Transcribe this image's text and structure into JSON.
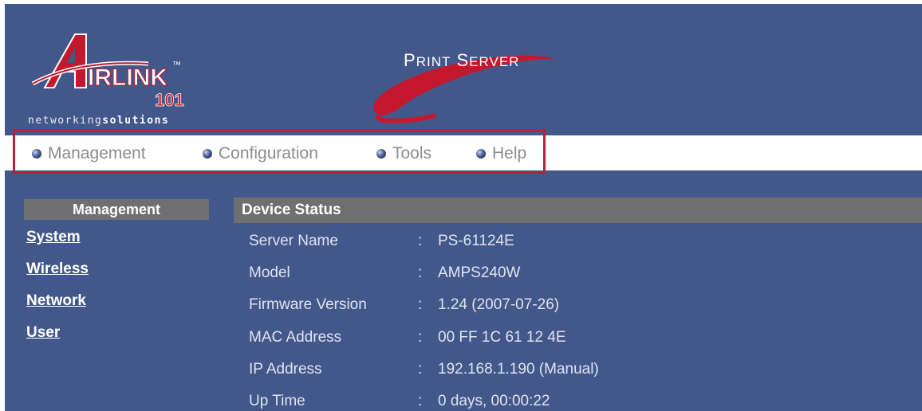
{
  "header": {
    "logo_word": "IRLINK",
    "logo_tm": "™",
    "logo_number": "101",
    "tagline_light": "networking",
    "tagline_bold": "solutions",
    "product_title_p": "P",
    "product_title_rint": "RINT",
    "product_title_s": "S",
    "product_title_erver": "ERVER"
  },
  "menu": {
    "items": [
      {
        "label": "Management"
      },
      {
        "label": "Configuration"
      },
      {
        "label": "Tools"
      },
      {
        "label": "Help"
      }
    ]
  },
  "sidebar": {
    "header": "Management",
    "links": [
      {
        "label": "System"
      },
      {
        "label": "Wireless"
      },
      {
        "label": "Network"
      },
      {
        "label": "User"
      }
    ]
  },
  "status": {
    "title": "Device Status",
    "separator": ":",
    "rows": [
      {
        "label": "Server Name",
        "value": "PS-61124E"
      },
      {
        "label": "Model",
        "value": "AMPS240W"
      },
      {
        "label": "Firmware Version",
        "value": "1.24 (2007-07-26)"
      },
      {
        "label": "MAC Address",
        "value": "00 FF 1C 61 12 4E"
      },
      {
        "label": "IP Address",
        "value": "192.168.1.190 (Manual)"
      },
      {
        "label": "Up Time",
        "value": "0 days, 00:00:22"
      }
    ]
  },
  "colors": {
    "background": "#43588a",
    "header_bar": "#6f6f6f",
    "highlight_border": "#b5203a",
    "logo_red": "#c4182f"
  }
}
